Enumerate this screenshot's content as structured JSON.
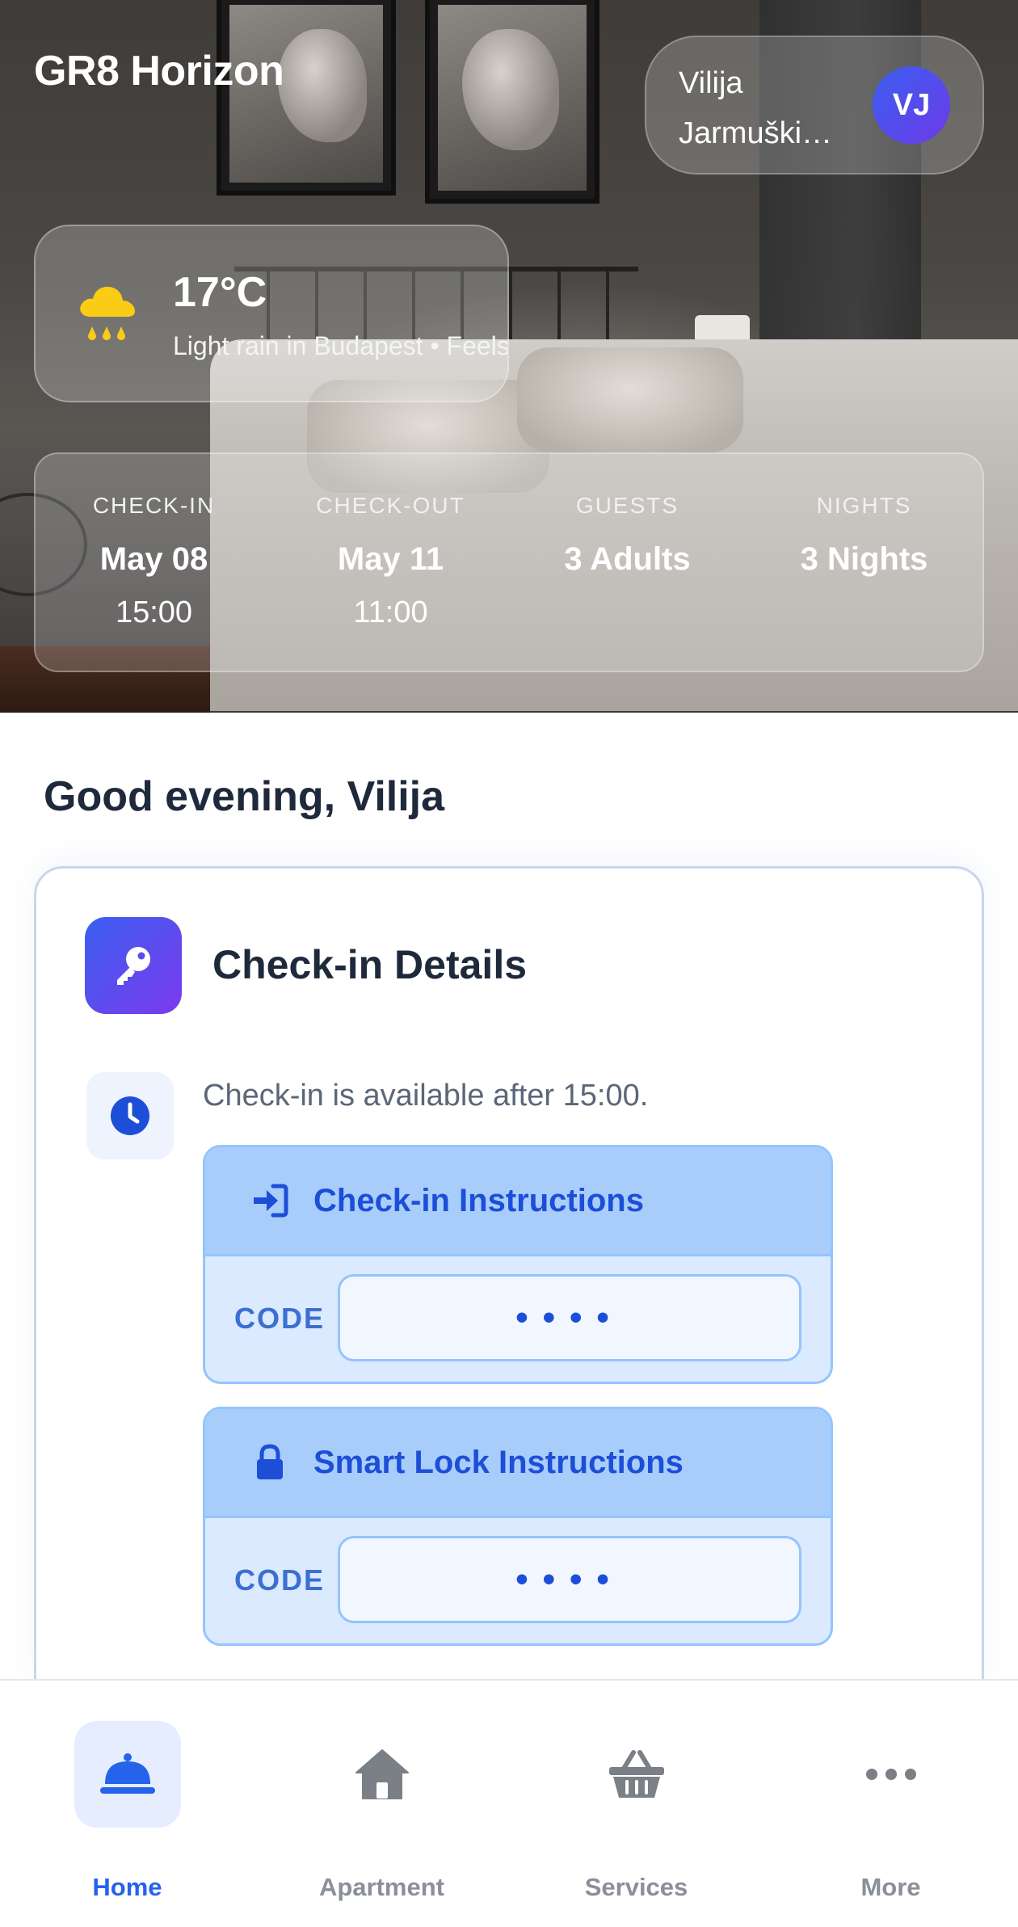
{
  "header": {
    "app_title": "GR8 Horizon",
    "user": {
      "name_line1": "Vilija",
      "name_line2": "Jarmuški…",
      "initials": "VJ"
    }
  },
  "weather": {
    "icon": "rain-cloud-icon",
    "temperature": "17°C",
    "description": "Light rain in Budapest • Feels"
  },
  "stay": {
    "check_in": {
      "label": "CHECK-IN",
      "date": "May 08",
      "time": "15:00"
    },
    "check_out": {
      "label": "CHECK-OUT",
      "date": "May 11",
      "time": "11:00"
    },
    "guests": {
      "label": "GUESTS",
      "value": "3 Adults"
    },
    "nights": {
      "label": "NIGHTS",
      "value": "3 Nights"
    }
  },
  "greeting": "Good evening, Vilija",
  "checkin_card": {
    "title": "Check-in Details",
    "icon": "key-icon",
    "availability": "Check-in is available after 15:00.",
    "sections": [
      {
        "title": "Check-in Instructions",
        "icon": "sign-in-icon",
        "code_label": "CODE",
        "code_masked": "••••"
      },
      {
        "title": "Smart Lock Instructions",
        "icon": "lock-icon",
        "code_label": "CODE",
        "code_masked": "••••"
      }
    ]
  },
  "bottom_nav": {
    "items": [
      {
        "label": "Home",
        "icon": "concierge-bell-icon",
        "active": true
      },
      {
        "label": "Apartment",
        "icon": "house-icon",
        "active": false
      },
      {
        "label": "Services",
        "icon": "basket-icon",
        "active": false
      },
      {
        "label": "More",
        "icon": "more-dots-icon",
        "active": false
      }
    ]
  },
  "colors": {
    "accent": "#2563eb",
    "instruction_header": "#a8cdfb",
    "instruction_body": "#dbeafe",
    "weather_icon": "#facc15"
  }
}
